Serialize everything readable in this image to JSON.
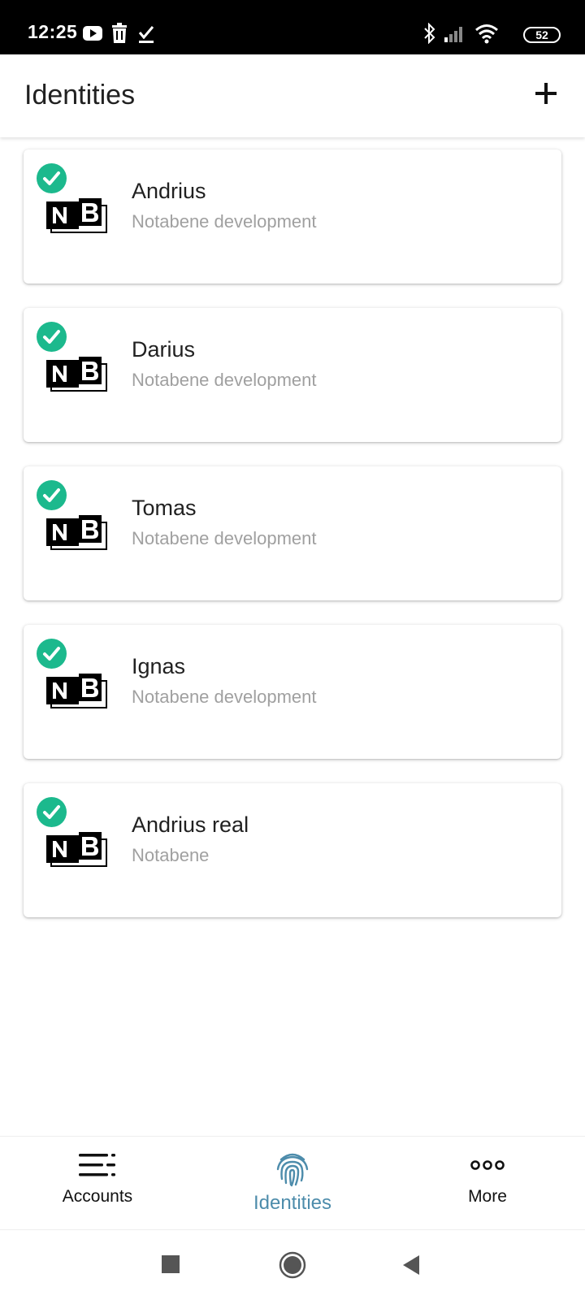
{
  "status_bar": {
    "time": "12:25",
    "battery": "52"
  },
  "header": {
    "title": "Identities"
  },
  "identities": [
    {
      "name": "Andrius",
      "org": "Notabene development"
    },
    {
      "name": "Darius",
      "org": "Notabene development"
    },
    {
      "name": "Tomas",
      "org": "Notabene development"
    },
    {
      "name": "Ignas",
      "org": "Notabene development"
    },
    {
      "name": "Andrius real",
      "org": "Notabene"
    }
  ],
  "bottom_nav": {
    "items": [
      {
        "label": "Accounts",
        "icon": "menu-lines-icon"
      },
      {
        "label": "Identities",
        "icon": "fingerprint-icon"
      },
      {
        "label": "More",
        "icon": "three-dots-icon"
      }
    ]
  },
  "colors": {
    "verified_green": "#1cb98d",
    "active_nav": "#4d8cab",
    "text_primary": "#212121",
    "text_secondary": "#a0a0a0"
  }
}
